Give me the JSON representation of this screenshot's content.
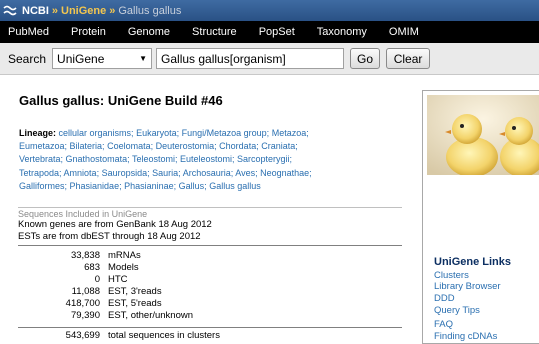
{
  "breadcrumb": {
    "ncbi": "NCBI",
    "unigene": "UniGene",
    "organism": "Gallus gallus",
    "sep": "»"
  },
  "nav": [
    "PubMed",
    "Protein",
    "Genome",
    "Structure",
    "PopSet",
    "Taxonomy",
    "OMIM"
  ],
  "search": {
    "label": "Search",
    "database": "UniGene",
    "query": "Gallus gallus[organism]",
    "go_label": "Go",
    "clear_label": "Clear"
  },
  "page_title": "Gallus gallus:   UniGene Build #46",
  "lineage": {
    "label": "Lineage:",
    "taxa": [
      "cellular organisms;",
      "Eukaryota;",
      "Fungi/Metazoa group;",
      "Metazoa;",
      "Eumetazoa;",
      "Bilateria;",
      "Coelomata;",
      "Deuterostomia;",
      "Chordata;",
      "Craniata;",
      "Vertebrata;",
      "Gnathostomata;",
      "Teleostomi;",
      "Euteleostomi;",
      "Sarcopterygii;",
      "Tetrapoda;",
      "Amniota;",
      "Sauropsida;",
      "Sauria;",
      "Archosauria;",
      "Aves;",
      "Neognathae;",
      "Galliformes;",
      "Phasianidae;",
      "Phasianinae;",
      "Gallus;",
      "Gallus gallus"
    ]
  },
  "sequences": {
    "header": "Sequences Included in UniGene",
    "known_genes": "Known genes are from GenBank 18 Aug 2012",
    "ests": "ESTs are from dbEST through 18 Aug 2012",
    "rows": [
      {
        "count": "33,838",
        "label": "mRNAs"
      },
      {
        "count": "683",
        "label": "Models"
      },
      {
        "count": "0",
        "label": "HTC"
      },
      {
        "count": "11,088",
        "label": "EST, 3'reads"
      },
      {
        "count": "418,700",
        "label": "EST, 5'reads"
      },
      {
        "count": "79,390",
        "label": "EST, other/unknown"
      },
      {
        "count": "543,699",
        "label": "total sequences in clusters"
      }
    ]
  },
  "sidebar": {
    "title": "UniGene Links",
    "links": [
      "Clusters",
      "Library Browser",
      "DDD",
      "Query Tips",
      "FAQ",
      "Finding cDNAs"
    ]
  }
}
